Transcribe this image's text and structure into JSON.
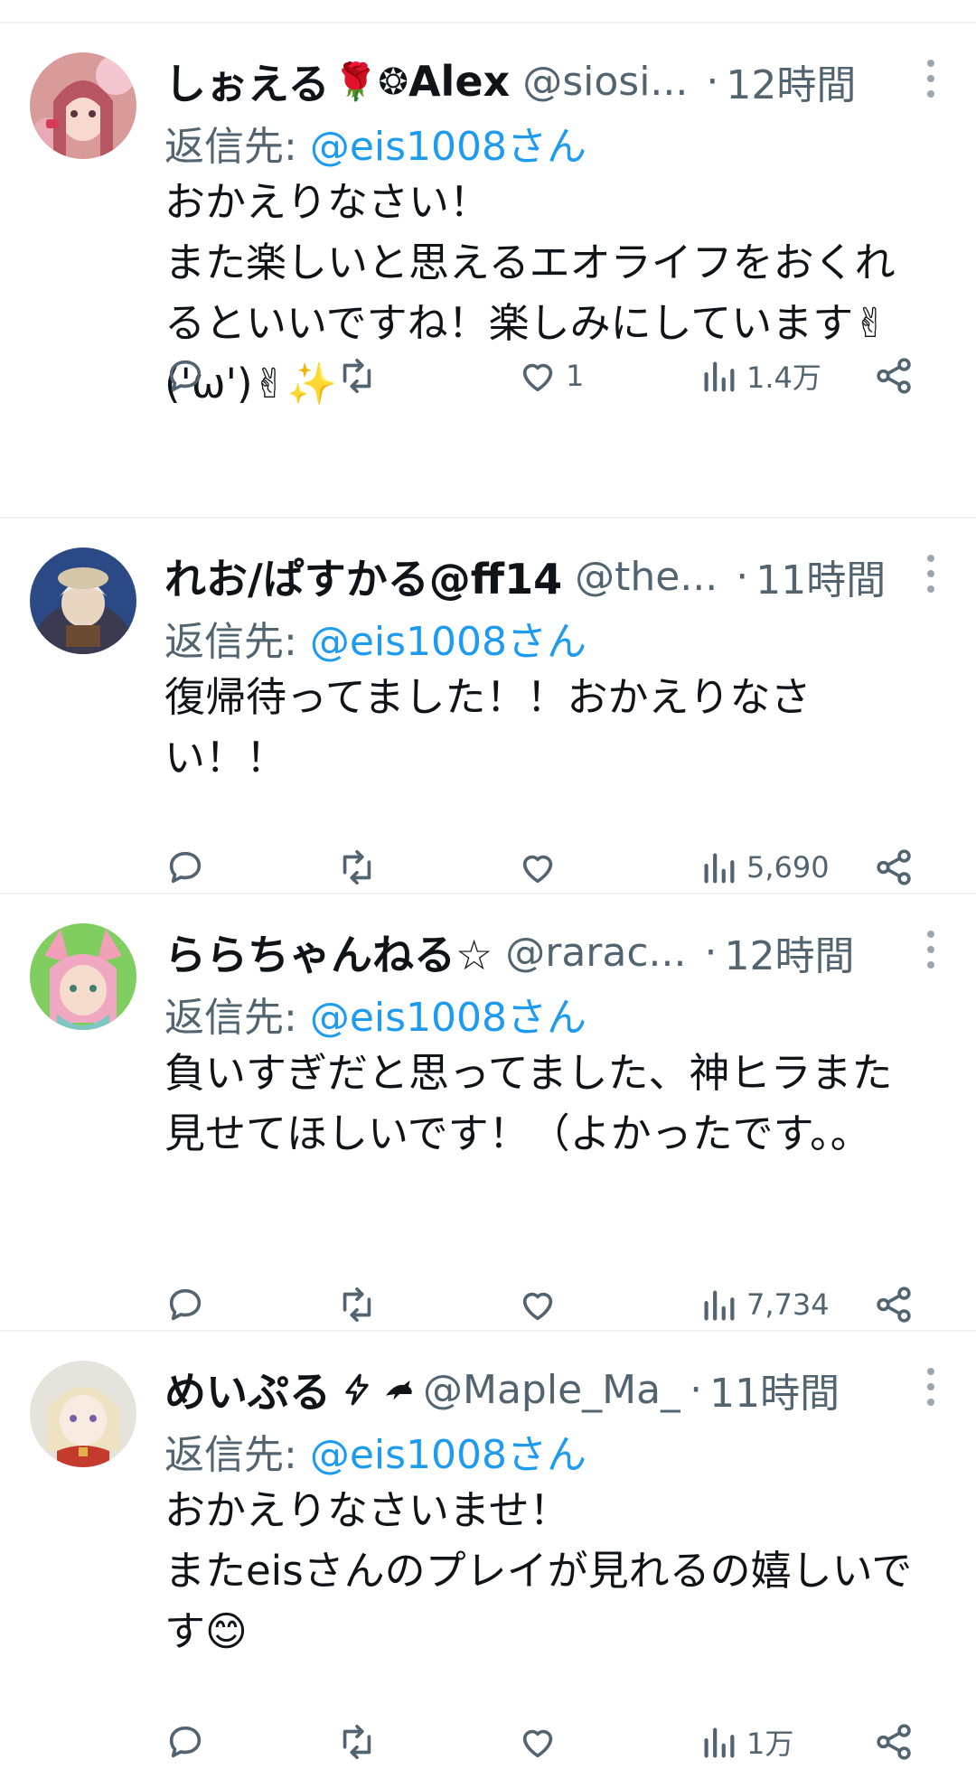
{
  "reply_label": "返信先: ",
  "tweets": [
    {
      "name": "しぉえる",
      "badges": "🌹❂",
      "name_suffix": "Alex",
      "handle": "@siosi...",
      "dot": "·",
      "time": "12時間",
      "reply_to": "@eis1008さん",
      "text": "おかえりなさい！\nまた楽しいと思えるエオライフをおくれるといいですね！楽しみにしています✌('ω')✌✨",
      "likes": "1",
      "views": "1.4万"
    },
    {
      "name": "れお/ぱすかる@ff14",
      "badges": "",
      "name_suffix": "",
      "handle": "@the...",
      "dot": "·",
      "time": "11時間",
      "reply_to": "@eis1008さん",
      "text": "復帰待ってました！！おかえりなさい！！",
      "likes": "",
      "views": "5,690"
    },
    {
      "name": "ららちゃんねる☆",
      "badges": "",
      "name_suffix": "",
      "handle": "@rarac...",
      "dot": "·",
      "time": "12時間",
      "reply_to": "@eis1008さん",
      "text": "負いすぎだと思ってました、神ヒラまた見せてほしいです！（よかったです。。",
      "likes": "",
      "views": "7,734"
    },
    {
      "name": "めいぷる",
      "badges": "",
      "name_suffix": "",
      "handle": "@Maple_Ma_",
      "dot": "·",
      "time": "11時間",
      "reply_to": "@eis1008さん",
      "text": "おかえりなさいませ！\nまたeisさんのプレイが見れるの嬉しいです😊",
      "likes": "",
      "views": "1万"
    }
  ],
  "icons": [
    "reply-icon",
    "retweet-icon",
    "like-icon",
    "views-icon",
    "share-icon",
    "more-icon",
    "bolt-icon",
    "bird-icon"
  ],
  "colors": {
    "mention": "#1d9bf0",
    "secondary": "#536471",
    "divider": "#eff3f4"
  }
}
